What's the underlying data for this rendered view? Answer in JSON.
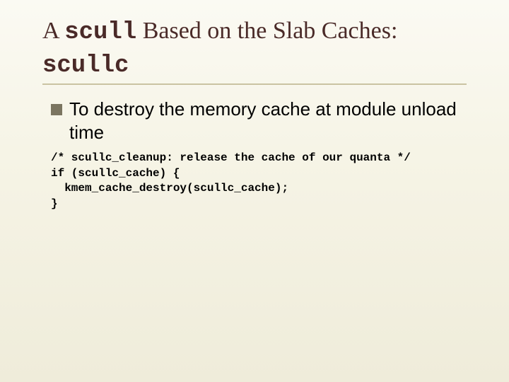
{
  "title": {
    "prefix": "A ",
    "mono1": "scull",
    "mid": " Based on the Slab Caches: ",
    "mono2": "scullc"
  },
  "bullet": "To destroy the memory cache at module unload time",
  "code": {
    "l1": "/* scullc_cleanup: release the cache of our quanta */",
    "l2": "if (scullc_cache) {",
    "l3": "  kmem_cache_destroy(scullc_cache);",
    "l4": "}"
  }
}
